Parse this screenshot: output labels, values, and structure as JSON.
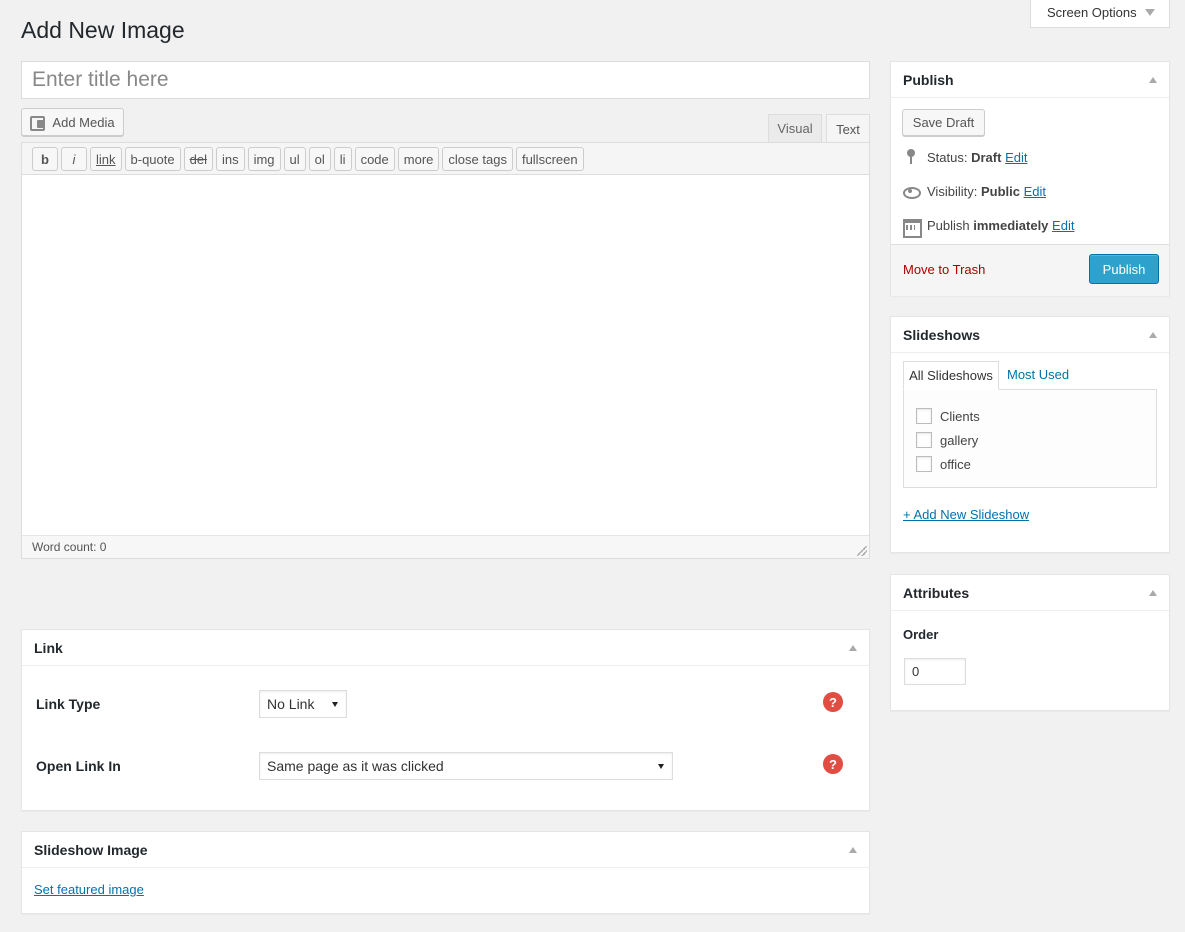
{
  "screen_options": {
    "label": "Screen Options"
  },
  "page": {
    "title": "Add New Image"
  },
  "title_field": {
    "placeholder": "Enter title here",
    "value": ""
  },
  "editor": {
    "add_media_label": "Add Media",
    "tabs": {
      "visual": "Visual",
      "text": "Text"
    },
    "quicktags": [
      "b",
      "i",
      "link",
      "b-quote",
      "del",
      "ins",
      "img",
      "ul",
      "ol",
      "li",
      "code",
      "more",
      "close tags",
      "fullscreen"
    ],
    "word_count": "Word count: 0"
  },
  "publish": {
    "title": "Publish",
    "save_draft": "Save Draft",
    "status_label": "Status:",
    "status_value": "Draft",
    "visibility_label": "Visibility:",
    "visibility_value": "Public",
    "publish_label": "Publish",
    "publish_value": "immediately",
    "edit": "Edit",
    "move_to_trash": "Move to Trash",
    "publish_button": "Publish"
  },
  "slideshows": {
    "title": "Slideshows",
    "tab_all": "All Slideshows",
    "tab_most_used": "Most Used",
    "items": [
      "Clients",
      "gallery",
      "office"
    ],
    "add_new": "+ Add New Slideshow"
  },
  "attributes": {
    "title": "Attributes",
    "order_label": "Order",
    "order_value": "0"
  },
  "link_box": {
    "title": "Link",
    "link_type_label": "Link Type",
    "link_type_value": "No Link",
    "open_link_label": "Open Link In",
    "open_link_value": "Same page as it was clicked",
    "help": "?"
  },
  "slideshow_image": {
    "title": "Slideshow Image",
    "set_featured": "Set featured image"
  },
  "colors": {
    "accent": "#0073aa",
    "publish_button": "#2ea2cc",
    "trash": "#a00",
    "help": "#e14d43"
  }
}
